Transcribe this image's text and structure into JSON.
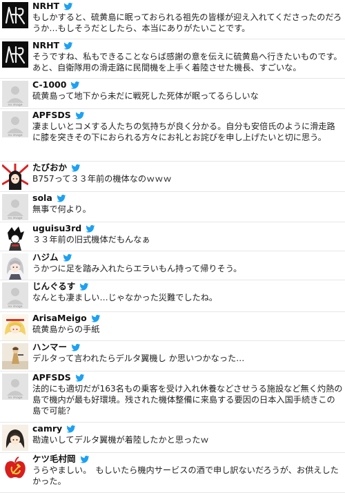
{
  "colors": {
    "twitter_blue": "#1da1f2",
    "divider": "#e6e6e6"
  },
  "tweets": [
    {
      "name": "NRHT",
      "avatar": "nrht-logo",
      "text": "もしかすると、硫黄島に眠っておられる祖先の皆様が迎え入れてくださったのだろうか…もしそうだとしたら、本当にありがたいことです。"
    },
    {
      "name": "NRHT",
      "avatar": "nrht-logo",
      "text": "そうですね、私もできることならば感謝の意を伝えに硫黄島へ行きたいものです。あと、自衛隊用の滑走路に民間機を上手く着陸させた機長、すごいな。"
    },
    {
      "name": "C-1000",
      "avatar": "no-image",
      "avatar_label": "no image",
      "text": "硫黄島って地下から未だに戦死した死体が眠ってるらしいな"
    },
    {
      "name": "APFSDS",
      "avatar": "no-image",
      "avatar_label": "no image",
      "text": "凄ましいとコメする人たちの気持ちが良く分かる。自分も安倍氏のように滑走路に膝を突きその下におられる方々にお礼とお詫びを申し上げたいと切に思う。"
    },
    {
      "name": "たびおか",
      "avatar": "anime-girl-rising-sun",
      "text": "B757って３３年前の機体なのｗｗｗ"
    },
    {
      "name": "sola",
      "avatar": "no-image",
      "avatar_label": "no image",
      "text": "無事で何より。"
    },
    {
      "name": "uguisu3rd",
      "avatar": "manga-character",
      "text": "３３年前の旧式機体だもんなぁ"
    },
    {
      "name": "ハジム",
      "avatar": "silver-hair-character",
      "text": "うかつに足を踏み入れたらエラいもん持って帰りそう。"
    },
    {
      "name": "じんぐるす",
      "avatar": "no-image",
      "avatar_label": "no image",
      "text": "なんとも凄ましい…じゃなかった災難でしたね。"
    },
    {
      "name": "ArisaMeigo",
      "avatar": "blonde-character",
      "text": "硫黄島からの手紙"
    },
    {
      "name": "ハンマー",
      "avatar": "figure-photo",
      "text": "デルタって言われたらデルタ翼機し か思いつかなった…"
    },
    {
      "name": "APFSDS",
      "avatar": "no-image",
      "avatar_label": "no image",
      "text": "法的にも適切だが163名もの乗客を受け入れ休養などさせうる施設など無く灼熱の島で機内が最も好環境。残された機体整備に来島する要因の日本入国手続きこの島で可能？"
    },
    {
      "name": "camry",
      "avatar": "dark-hair-character",
      "text": "勘違いしてデルタ翼機が着陸したかと思ったｗ"
    },
    {
      "name": "ケツ毛村岡",
      "avatar": "apple-hammer-sickle",
      "text": "うらやましい。　もしいたら機内サービスの酒で申し訳ないだろうが、お供えしたかった。"
    }
  ]
}
